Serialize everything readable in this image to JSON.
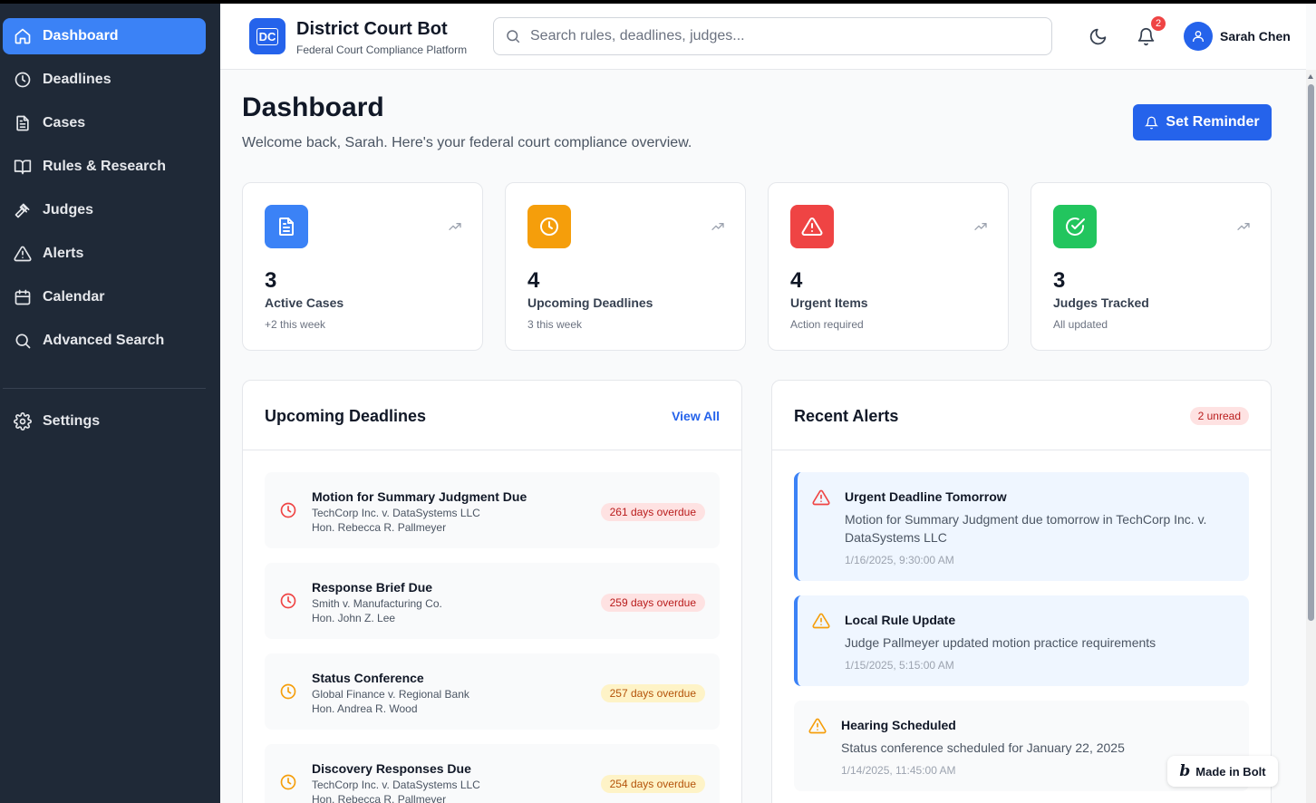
{
  "sidebar": {
    "items": [
      {
        "label": "Dashboard",
        "icon": "home-icon",
        "active": true
      },
      {
        "label": "Deadlines",
        "icon": "clock-icon"
      },
      {
        "label": "Cases",
        "icon": "document-icon"
      },
      {
        "label": "Rules & Research",
        "icon": "book-icon"
      },
      {
        "label": "Judges",
        "icon": "gavel-icon"
      },
      {
        "label": "Alerts",
        "icon": "warning-icon"
      },
      {
        "label": "Calendar",
        "icon": "calendar-icon"
      },
      {
        "label": "Advanced Search",
        "icon": "search-icon"
      }
    ],
    "settings_label": "Settings"
  },
  "header": {
    "logo_text": "DC",
    "title": "District Court Bot",
    "subtitle": "Federal Court Compliance Platform",
    "search_placeholder": "Search rules, deadlines, judges...",
    "notification_count": "2",
    "user_name": "Sarah Chen"
  },
  "main": {
    "title": "Dashboard",
    "subtitle": "Welcome back, Sarah. Here's your federal court compliance overview.",
    "reminder_button": "Set Reminder",
    "stats": [
      {
        "value": "3",
        "label": "Active Cases",
        "sub": "+2 this week",
        "color": "#3b82f6",
        "icon": "document-icon"
      },
      {
        "value": "4",
        "label": "Upcoming Deadlines",
        "sub": "3 this week",
        "color": "#f59e0b",
        "icon": "clock-icon"
      },
      {
        "value": "4",
        "label": "Urgent Items",
        "sub": "Action required",
        "color": "#ef4444",
        "icon": "warning-icon"
      },
      {
        "value": "3",
        "label": "Judges Tracked",
        "sub": "All updated",
        "color": "#22c55e",
        "icon": "check-circle-icon"
      }
    ]
  },
  "deadlines": {
    "title": "Upcoming Deadlines",
    "view_all": "View All",
    "items": [
      {
        "title": "Motion for Summary Judgment Due",
        "case": "TechCorp Inc. v. DataSystems LLC",
        "judge": "Hon. Rebecca R. Pallmeyer",
        "status": "261 days overdue",
        "severity": "red"
      },
      {
        "title": "Response Brief Due",
        "case": "Smith v. Manufacturing Co.",
        "judge": "Hon. John Z. Lee",
        "status": "259 days overdue",
        "severity": "red"
      },
      {
        "title": "Status Conference",
        "case": "Global Finance v. Regional Bank",
        "judge": "Hon. Andrea R. Wood",
        "status": "257 days overdue",
        "severity": "yellow"
      },
      {
        "title": "Discovery Responses Due",
        "case": "TechCorp Inc. v. DataSystems LLC",
        "judge": "Hon. Rebecca R. Pallmeyer",
        "status": "254 days overdue",
        "severity": "yellow"
      }
    ]
  },
  "alerts": {
    "title": "Recent Alerts",
    "unread_badge": "2 unread",
    "items": [
      {
        "title": "Urgent Deadline Tomorrow",
        "message": "Motion for Summary Judgment due tomorrow in TechCorp Inc. v. DataSystems LLC",
        "time": "1/16/2025, 9:30:00 AM",
        "color": "#ef4444"
      },
      {
        "title": "Local Rule Update",
        "message": "Judge Pallmeyer updated motion practice requirements",
        "time": "1/15/2025, 5:15:00 AM",
        "color": "#f59e0b"
      },
      {
        "title": "Hearing Scheduled",
        "message": "Status conference scheduled for January 22, 2025",
        "time": "1/14/2025, 11:45:00 AM",
        "color": "#f59e0b"
      }
    ]
  },
  "badge": {
    "label": "Made in Bolt"
  },
  "colors": {
    "accent": "#2563eb",
    "sidebar": "#1f2937",
    "active_nav": "#3b82f6"
  }
}
